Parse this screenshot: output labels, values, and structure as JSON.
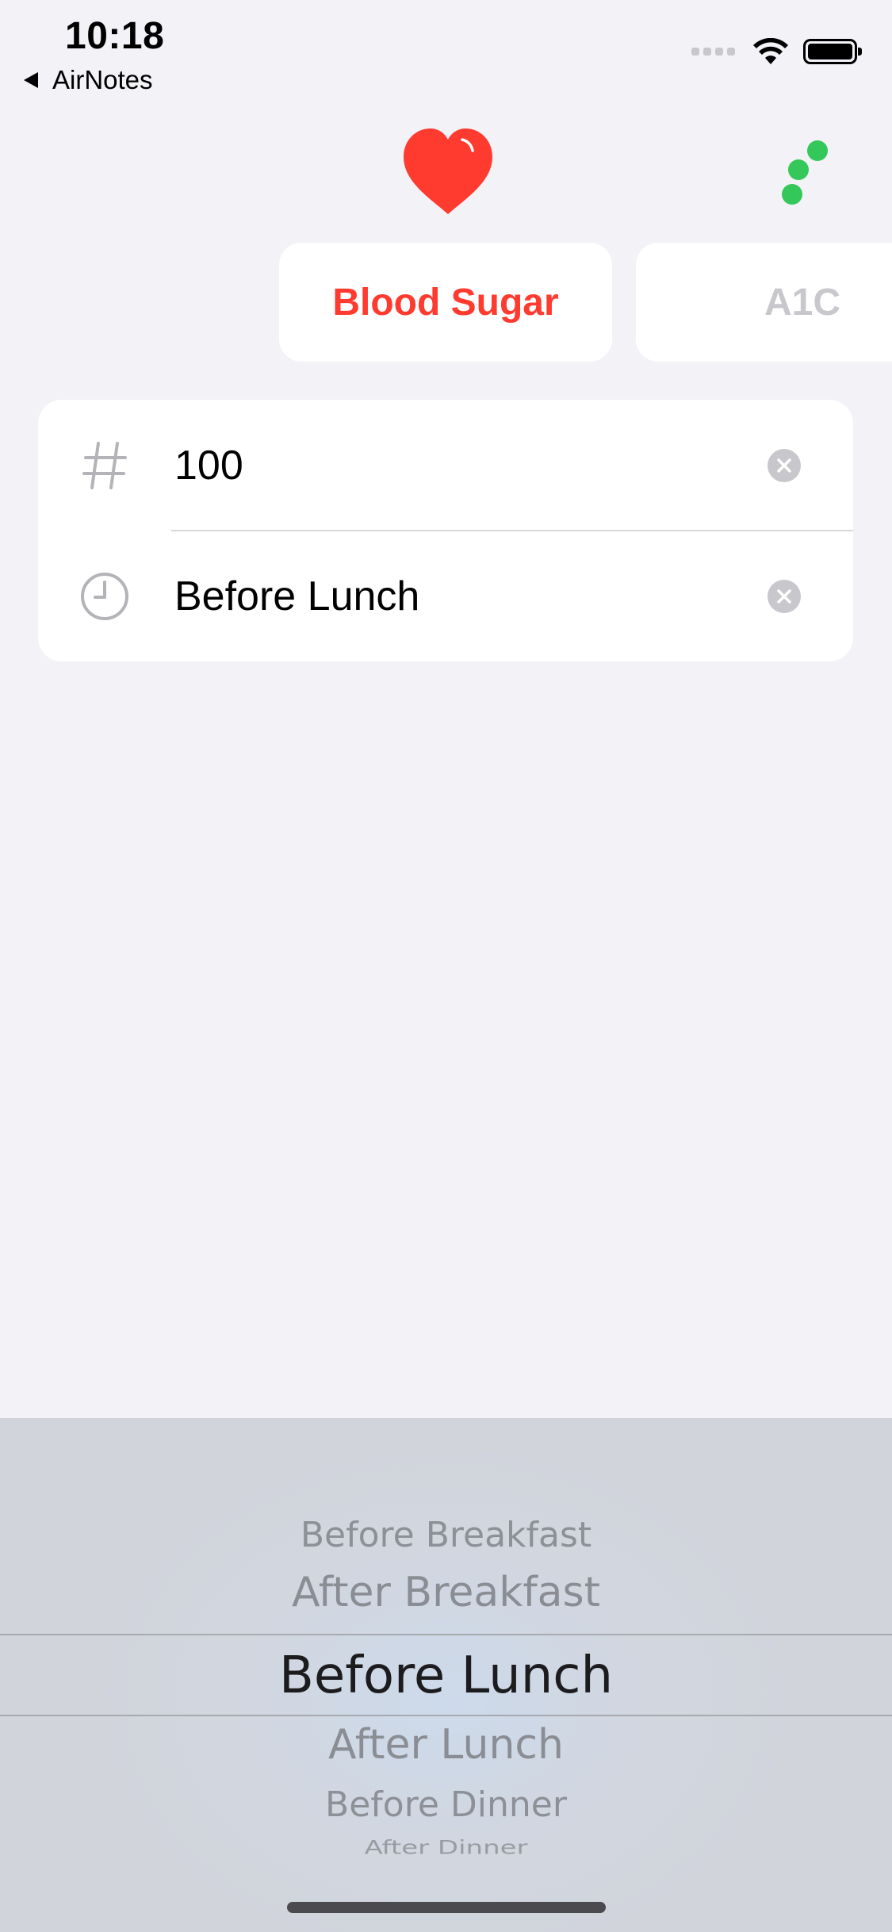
{
  "status_bar": {
    "time": "10:18",
    "back_app": "AirNotes"
  },
  "icons": {
    "header_left": "heart-icon",
    "header_right": "dots-icon",
    "value_row": "hash-icon",
    "time_row": "clock-icon",
    "clear": "clear-circle-icon"
  },
  "colors": {
    "accent_red": "#ff3b30",
    "green": "#34c759",
    "background": "#f2f2f7"
  },
  "tabs": [
    {
      "label": "Blood Sugar",
      "selected": true
    },
    {
      "label": "A1C",
      "selected": false
    }
  ],
  "form": {
    "value": "100",
    "meal_time": "Before Lunch"
  },
  "picker": {
    "options": [
      "Before Breakfast",
      "After Breakfast",
      "Before Lunch",
      "After Lunch",
      "Before Dinner",
      "After Dinner"
    ],
    "selected": "Before Lunch"
  }
}
